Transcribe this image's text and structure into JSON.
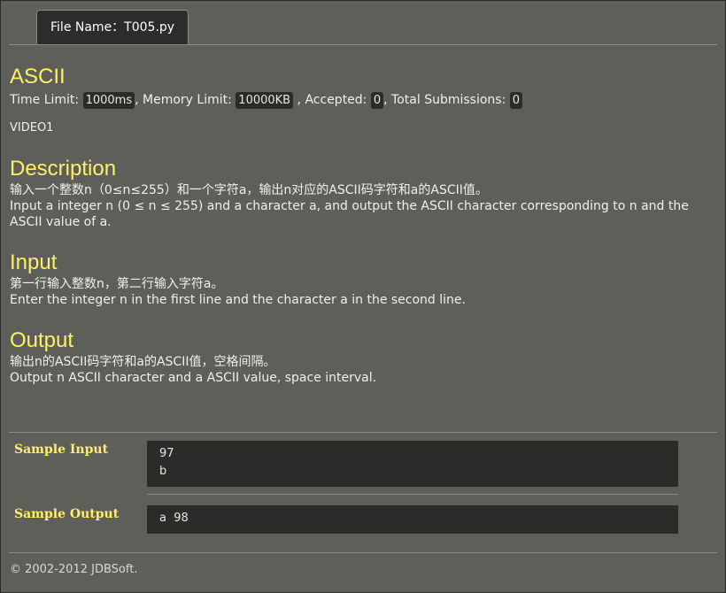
{
  "tab": {
    "label": "File Name：T005.py"
  },
  "problem": {
    "title": "ASCII",
    "time_label": "Time Limit:",
    "time_value": "1000ms",
    "memory_label": ", Memory Limit:",
    "memory_value": "10000KB",
    "accepted_label": ", Accepted:",
    "accepted_value": "0",
    "total_label": ", Total Submissions:",
    "total_value": "0",
    "video": "VIDEO1"
  },
  "description": {
    "heading": "Description",
    "line_cn": "输入一个整数n（0≤n≤255）和一个字符a，输出n对应的ASCII码字符和a的ASCII值。",
    "line_en": "Input a integer n (0 ≤ n ≤ 255) and a character a, and output the ASCII character corresponding to n and the ASCII value of a."
  },
  "input": {
    "heading": "Input",
    "line_cn": "第一行输入整数n，第二行输入字符a。",
    "line_en": "Enter the integer n in the first line and the character a in the second line."
  },
  "output": {
    "heading": "Output",
    "line_cn": "输出n的ASCII码字符和a的ASCII值，空格间隔。",
    "line_en": "Output n ASCII character and a ASCII value, space interval."
  },
  "samples": {
    "input_label": "Sample Input",
    "input_lines": [
      "97",
      "b"
    ],
    "output_label": "Sample Output",
    "output_lines": [
      "a  98"
    ]
  },
  "footer": "© 2002-2012  JDBSoft."
}
